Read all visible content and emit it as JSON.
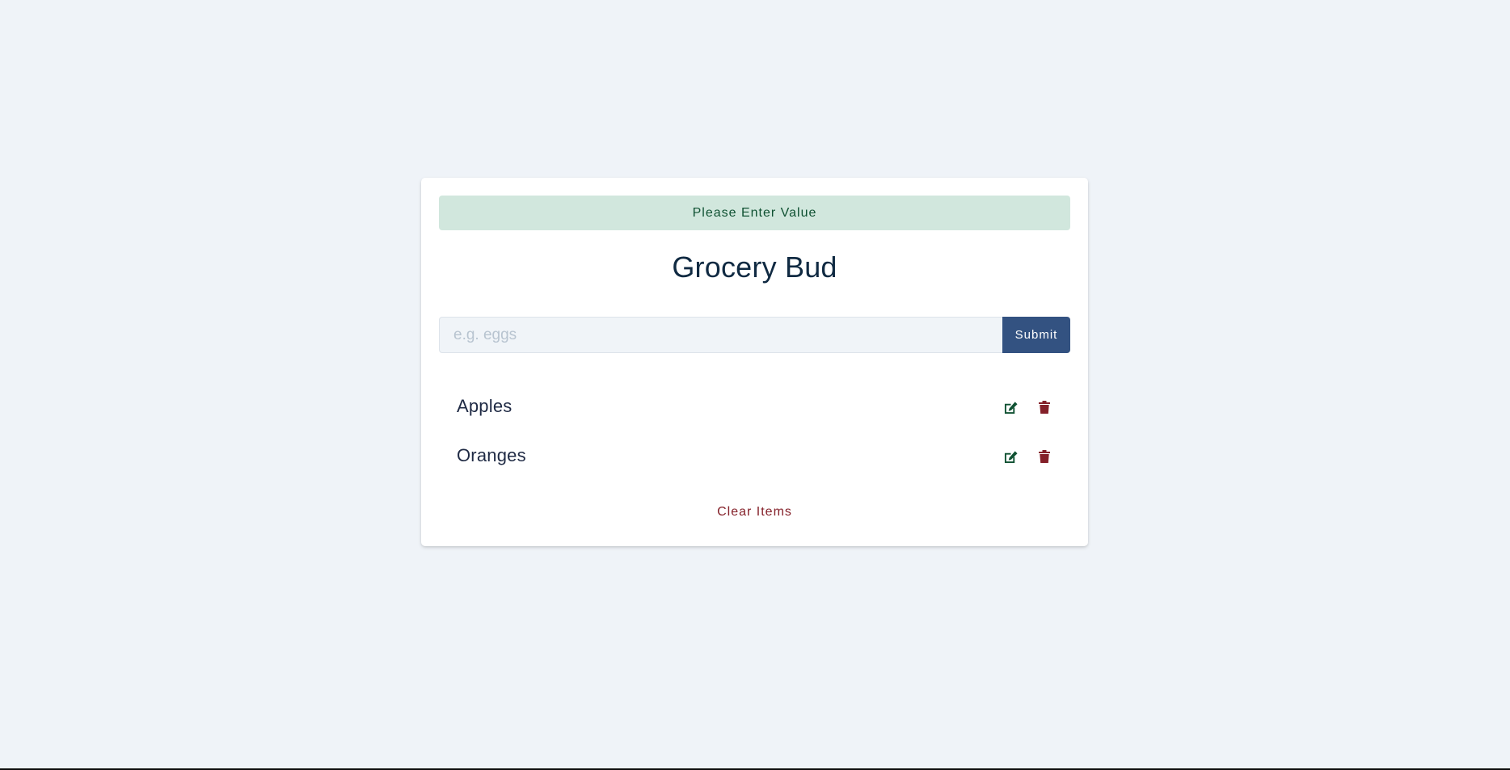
{
  "alert": {
    "text": "Please Enter Value",
    "bg_color": "#d1e7dd",
    "text_color": "#0f5132"
  },
  "app": {
    "title": "Grocery Bud"
  },
  "form": {
    "input_value": "",
    "input_placeholder": "e.g. eggs",
    "submit_label": "Submit",
    "submit_color": "#335281"
  },
  "items": [
    {
      "title": "Apples",
      "edit_icon": "edit-icon",
      "delete_icon": "trash-icon"
    },
    {
      "title": "Oranges",
      "edit_icon": "edit-icon",
      "delete_icon": "trash-icon"
    }
  ],
  "clear_label": "Clear Items",
  "colors": {
    "background": "#eff3f8",
    "edit": "#0f5132",
    "delete": "#842029"
  }
}
